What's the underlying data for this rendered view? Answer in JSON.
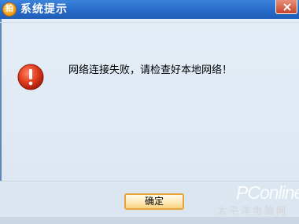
{
  "window": {
    "title": "系统提示",
    "app_icon_text": "拍",
    "close_icon": "close-icon"
  },
  "dialog": {
    "icon": "error-icon",
    "message": "网络连接失败，请检查好本地网络！",
    "ok_label": "确定"
  },
  "watermark": {
    "brand": "PConline",
    "subtitle": "太平洋电脑网"
  },
  "colors": {
    "titlebar": "#2a6fcb",
    "error_red": "#d8331f",
    "button_border": "#e8a33c"
  }
}
